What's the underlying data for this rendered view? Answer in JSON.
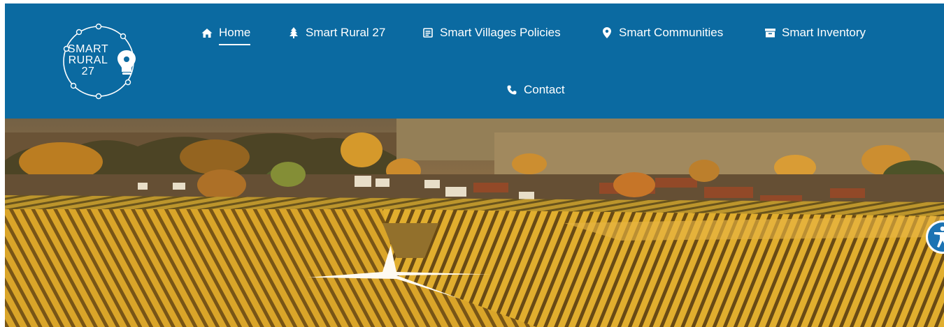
{
  "brand": {
    "logo_line1": "SMART",
    "logo_line2": "RURAL",
    "logo_line3": "27"
  },
  "nav": {
    "items": [
      {
        "label": "Home",
        "icon": "home-icon",
        "active": true
      },
      {
        "label": "Smart Rural 27",
        "icon": "tree-icon"
      },
      {
        "label": "Smart Villages Policies",
        "icon": "document-icon"
      },
      {
        "label": "Smart Communities",
        "icon": "map-marker-icon"
      },
      {
        "label": "Smart Inventory",
        "icon": "archive-icon"
      },
      {
        "label": "Contact",
        "icon": "phone-icon"
      }
    ]
  },
  "hero": {
    "image": "autumn-vineyard-village-landscape"
  },
  "accessibility": {
    "icon": "accessibility-icon"
  },
  "colors": {
    "header_bg": "#0b6aa1",
    "nav_text": "#ffffff",
    "accessibility_bg": "#1c73b3"
  }
}
